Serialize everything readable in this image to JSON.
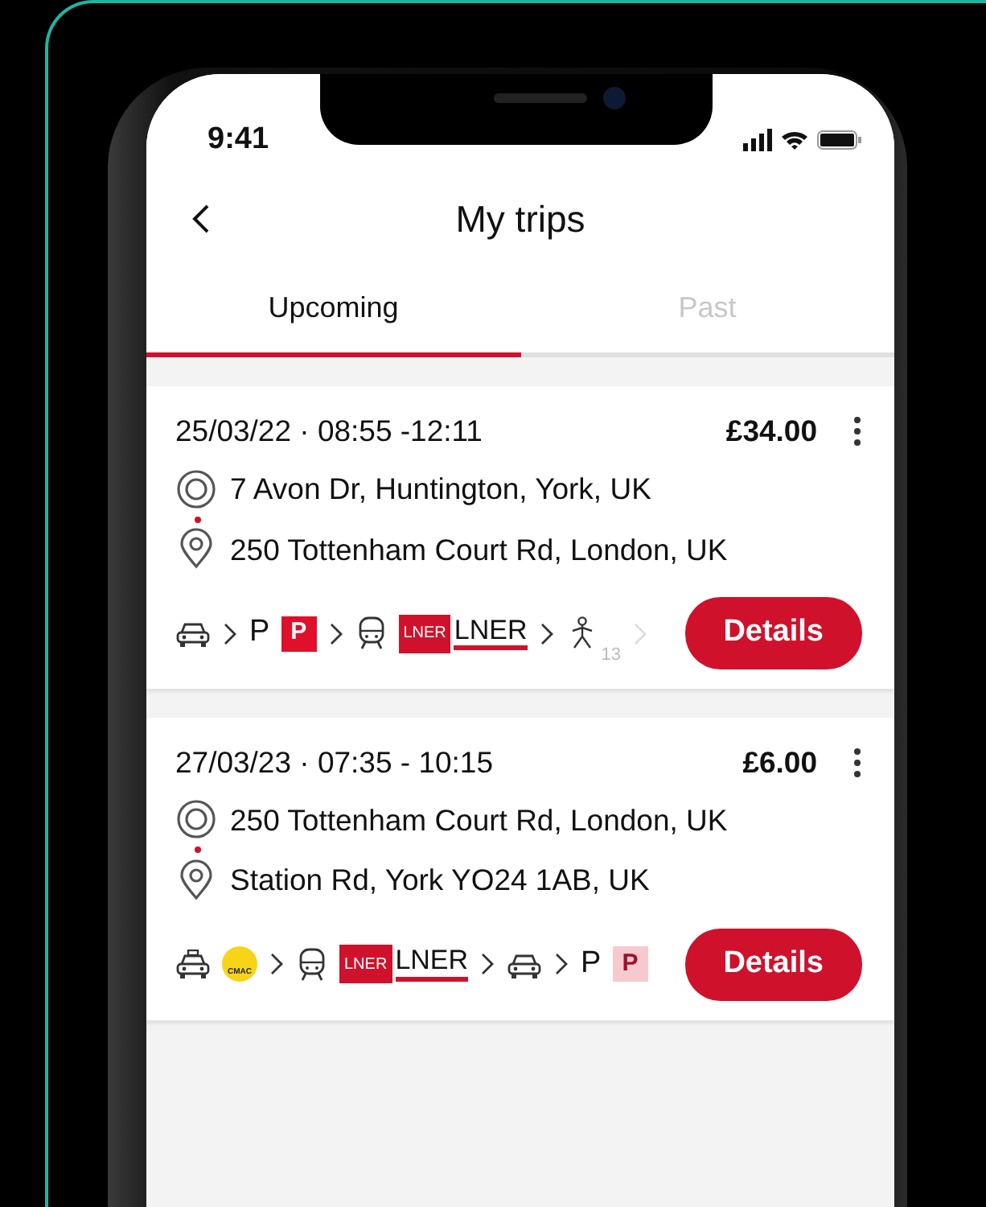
{
  "status_bar": {
    "time": "9:41"
  },
  "header": {
    "title": "My trips"
  },
  "tabs": [
    {
      "label": "Upcoming",
      "selected": true
    },
    {
      "label": "Past",
      "selected": false
    }
  ],
  "trips": [
    {
      "when": "25/03/22 · 08:55 -12:11",
      "price": "£34.00",
      "origin": "7 Avon Dr, Huntington, York, UK",
      "destination": "250 Tottenham Court Rd, London, UK",
      "more_legs": true,
      "button": "Details",
      "legs": [
        {
          "kind": "car"
        },
        {
          "kind": "parking",
          "label": "P",
          "logo": "P",
          "faded": false
        },
        {
          "kind": "train",
          "logo": "LNER",
          "label": "LNER"
        },
        {
          "kind": "walk",
          "label": "13"
        }
      ]
    },
    {
      "when": "27/03/23 · 07:35 - 10:15",
      "price": "£6.00",
      "origin": "250 Tottenham Court Rd, London, UK",
      "destination": "Station Rd, York YO24 1AB, UK",
      "more_legs": false,
      "button": "Details",
      "legs": [
        {
          "kind": "taxi",
          "logo": "CMAC"
        },
        {
          "kind": "train",
          "logo": "LNER",
          "label": "LNER"
        },
        {
          "kind": "car"
        },
        {
          "kind": "parking",
          "label": "P",
          "logo": "P",
          "faded": true
        }
      ]
    }
  ]
}
